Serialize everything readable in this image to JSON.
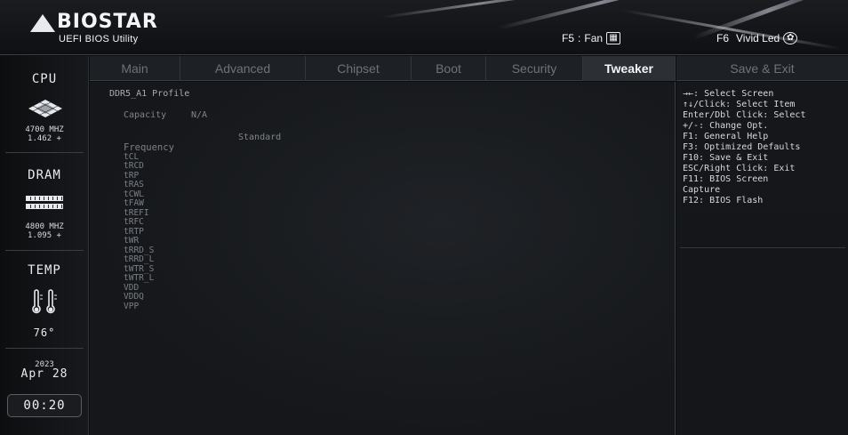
{
  "header": {
    "brand": "BIOSTAR",
    "subtitle": "UEFI BIOS Utility",
    "f5": {
      "key": "F5",
      "label": "Fan",
      "icon": "fan-grid-icon"
    },
    "f6": {
      "key": "F6",
      "label": "Vivid Led",
      "icon": "led-flower-icon"
    }
  },
  "left": {
    "cpu_title": "CPU",
    "cpu_freq": "4700 MHZ",
    "cpu_volt": "1.462 +",
    "dram_title": "DRAM",
    "dram_freq": "4800 MHZ",
    "dram_volt": "1.095 +",
    "temp_title": "TEMP",
    "temp_value": "76°",
    "year": "2023",
    "date": "Apr 28",
    "time": "00:20"
  },
  "tabs": [
    {
      "label": "Main"
    },
    {
      "label": "Advanced"
    },
    {
      "label": "Chipset"
    },
    {
      "label": "Boot"
    },
    {
      "label": "Security"
    },
    {
      "label": "Tweaker",
      "active": true
    }
  ],
  "save_exit": "Save & Exit",
  "main": {
    "profile": "DDR5_A1 Profile",
    "capacity_label": "Capacity",
    "capacity_value": "N/A",
    "column_header": "Standard",
    "items": [
      "Frequency",
      "tCL",
      "tRCD",
      "tRP",
      "tRAS",
      "tCWL",
      "tFAW",
      "tREFI",
      "tRFC",
      "tRTP",
      "tWR",
      "tRRD_S",
      "tRRD_L",
      "tWTR_S",
      "tWTR_L",
      "VDD",
      "VDDQ",
      "VPP"
    ]
  },
  "help": [
    "→←: Select Screen",
    "↑↓/Click: Select Item",
    "Enter/Dbl Click: Select",
    "+/-: Change Opt.",
    "F1: General Help",
    "F3: Optimized Defaults",
    "F10: Save & Exit",
    "ESC/Right Click: Exit",
    "F11: BIOS Screen",
    "Capture",
    "F12: BIOS Flash"
  ]
}
